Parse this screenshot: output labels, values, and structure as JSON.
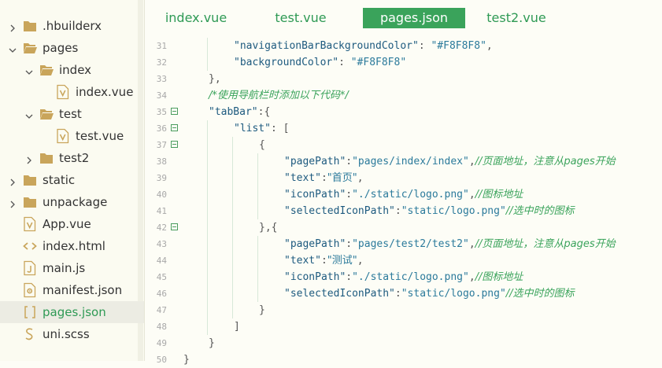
{
  "sidebar": {
    "items": [
      {
        "label": ".hbuilderx",
        "icon": "folder-icon",
        "expandable": true,
        "expanded": false,
        "level": 0
      },
      {
        "label": "pages",
        "icon": "folder-open-icon",
        "expandable": true,
        "expanded": true,
        "level": 0
      },
      {
        "label": "index",
        "icon": "folder-open-icon",
        "expandable": true,
        "expanded": true,
        "level": 1
      },
      {
        "label": "index.vue",
        "icon": "vue-file-icon",
        "expandable": false,
        "level": 2
      },
      {
        "label": "test",
        "icon": "folder-open-icon",
        "expandable": true,
        "expanded": true,
        "level": 1
      },
      {
        "label": "test.vue",
        "icon": "vue-file-icon",
        "expandable": false,
        "level": 2
      },
      {
        "label": "test2",
        "icon": "folder-icon",
        "expandable": true,
        "expanded": false,
        "level": 1
      },
      {
        "label": "static",
        "icon": "folder-icon",
        "expandable": true,
        "expanded": false,
        "level": 0
      },
      {
        "label": "unpackage",
        "icon": "folder-icon",
        "expandable": true,
        "expanded": false,
        "level": 0
      },
      {
        "label": "App.vue",
        "icon": "vue-file-icon",
        "expandable": false,
        "level": 0
      },
      {
        "label": "index.html",
        "icon": "code-file-icon",
        "expandable": false,
        "level": 0
      },
      {
        "label": "main.js",
        "icon": "js-file-icon",
        "expandable": false,
        "level": 0
      },
      {
        "label": "manifest.json",
        "icon": "settings-file-icon",
        "expandable": false,
        "level": 0
      },
      {
        "label": "pages.json",
        "icon": "json-file-icon",
        "expandable": false,
        "level": 0,
        "selected": true
      },
      {
        "label": "uni.scss",
        "icon": "scss-file-icon",
        "expandable": false,
        "level": 0
      }
    ]
  },
  "tabs": [
    {
      "label": "index.vue",
      "active": false
    },
    {
      "label": "test.vue",
      "active": false
    },
    {
      "label": "pages.json",
      "active": true
    },
    {
      "label": "test2.vue",
      "active": false
    }
  ],
  "editor": {
    "lines": [
      {
        "num": "31",
        "indent": 2,
        "fold": false,
        "tokens": [
          [
            "str",
            "\"navigationBarBackgroundColor\""
          ],
          [
            "pun",
            ": "
          ],
          [
            "val",
            "\"#F8F8F8\""
          ],
          [
            "pun",
            ","
          ]
        ]
      },
      {
        "num": "32",
        "indent": 2,
        "fold": false,
        "tokens": [
          [
            "str",
            "\"backgroundColor\""
          ],
          [
            "pun",
            ": "
          ],
          [
            "val",
            "\"#F8F8F8\""
          ]
        ]
      },
      {
        "num": "33",
        "indent": 1,
        "fold": false,
        "tokens": [
          [
            "pun",
            "},"
          ]
        ]
      },
      {
        "num": "34",
        "indent": 1,
        "fold": false,
        "tokens": [
          [
            "cmt",
            "/*使用导航栏时添加以下代码*/"
          ]
        ]
      },
      {
        "num": "35",
        "indent": 1,
        "fold": true,
        "tokens": [
          [
            "str",
            "\"tabBar\""
          ],
          [
            "pun",
            ":{"
          ]
        ]
      },
      {
        "num": "36",
        "indent": 2,
        "fold": true,
        "tokens": [
          [
            "str",
            "\"list\""
          ],
          [
            "pun",
            ": ["
          ]
        ]
      },
      {
        "num": "37",
        "indent": 3,
        "fold": true,
        "tokens": [
          [
            "pun",
            "{"
          ]
        ]
      },
      {
        "num": "38",
        "indent": 4,
        "fold": false,
        "tokens": [
          [
            "str",
            "\"pagePath\""
          ],
          [
            "pun",
            ":"
          ],
          [
            "val",
            "\"pages/index/index\""
          ],
          [
            "pun",
            ","
          ],
          [
            "cmt",
            "//页面地址，注意从pages开始"
          ]
        ]
      },
      {
        "num": "39",
        "indent": 4,
        "fold": false,
        "tokens": [
          [
            "str",
            "\"text\""
          ],
          [
            "pun",
            ":"
          ],
          [
            "val",
            "\"首页\""
          ],
          [
            "pun",
            ","
          ]
        ]
      },
      {
        "num": "40",
        "indent": 4,
        "fold": false,
        "tokens": [
          [
            "str",
            "\"iconPath\""
          ],
          [
            "pun",
            ":"
          ],
          [
            "val",
            "\"./static/logo.png\""
          ],
          [
            "pun",
            ","
          ],
          [
            "cmt",
            "//图标地址"
          ]
        ]
      },
      {
        "num": "41",
        "indent": 4,
        "fold": false,
        "tokens": [
          [
            "str",
            "\"selectedIconPath\""
          ],
          [
            "pun",
            ":"
          ],
          [
            "val",
            "\"static/logo.png\""
          ],
          [
            "cmt",
            "//选中时的图标"
          ]
        ]
      },
      {
        "num": "42",
        "indent": 3,
        "fold": true,
        "tokens": [
          [
            "pun",
            "},{"
          ]
        ]
      },
      {
        "num": "43",
        "indent": 4,
        "fold": false,
        "tokens": [
          [
            "str",
            "\"pagePath\""
          ],
          [
            "pun",
            ":"
          ],
          [
            "val",
            "\"pages/test2/test2\""
          ],
          [
            "pun",
            ","
          ],
          [
            "cmt",
            "//页面地址，注意从pages开始"
          ]
        ]
      },
      {
        "num": "44",
        "indent": 4,
        "fold": false,
        "tokens": [
          [
            "str",
            "\"text\""
          ],
          [
            "pun",
            ":"
          ],
          [
            "val",
            "\"测试\""
          ],
          [
            "pun",
            ","
          ]
        ]
      },
      {
        "num": "45",
        "indent": 4,
        "fold": false,
        "tokens": [
          [
            "str",
            "\"iconPath\""
          ],
          [
            "pun",
            ":"
          ],
          [
            "val",
            "\"./static/logo.png\""
          ],
          [
            "pun",
            ","
          ],
          [
            "cmt",
            "//图标地址"
          ]
        ]
      },
      {
        "num": "46",
        "indent": 4,
        "fold": false,
        "tokens": [
          [
            "str",
            "\"selectedIconPath\""
          ],
          [
            "pun",
            ":"
          ],
          [
            "val",
            "\"static/logo.png\""
          ],
          [
            "cmt",
            "//选中时的图标"
          ]
        ]
      },
      {
        "num": "47",
        "indent": 3,
        "fold": false,
        "tokens": [
          [
            "pun",
            "}"
          ]
        ]
      },
      {
        "num": "48",
        "indent": 2,
        "fold": false,
        "tokens": [
          [
            "pun",
            "]"
          ]
        ]
      },
      {
        "num": "49",
        "indent": 1,
        "fold": false,
        "tokens": [
          [
            "pun",
            "}"
          ]
        ]
      },
      {
        "num": "50",
        "indent": 0,
        "fold": false,
        "tokens": [
          [
            "pun",
            "}"
          ]
        ]
      }
    ]
  },
  "colors": {
    "accent": "#3aa35b",
    "icon": "#c9a55b",
    "key": "#1d5a7f",
    "value": "#2b7a9b",
    "comment": "#3aa35b"
  }
}
